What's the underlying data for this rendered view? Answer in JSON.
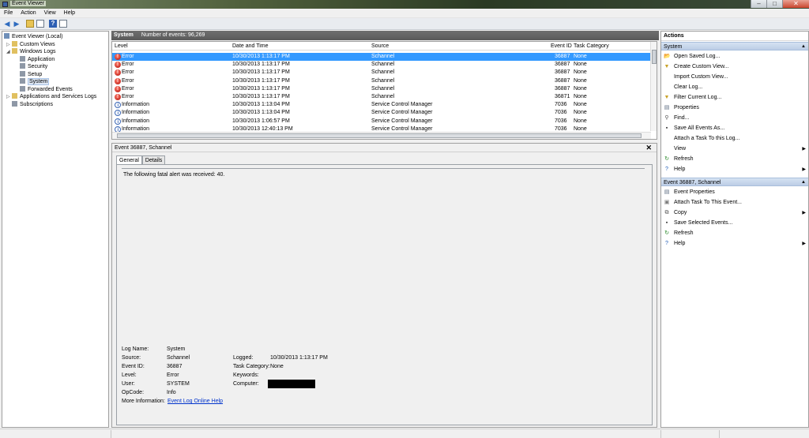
{
  "window": {
    "title": "Event Viewer"
  },
  "menu": [
    "File",
    "Action",
    "View",
    "Help"
  ],
  "tree": {
    "root": "Event Viewer (Local)",
    "custom_views": "Custom Views",
    "windows_logs": "Windows Logs",
    "logs": [
      "Application",
      "Security",
      "Setup",
      "System",
      "Forwarded Events"
    ],
    "app_services": "Applications and Services Logs",
    "subscriptions": "Subscriptions"
  },
  "grid": {
    "title": "System",
    "count_text": "Number of events: 96,269",
    "columns": [
      "Level",
      "Date and Time",
      "Source",
      "Event ID",
      "Task Category"
    ],
    "rows": [
      {
        "level": "Error",
        "date": "10/30/2013 1:13:17 PM",
        "source": "Schannel",
        "id": "36887",
        "task": "None"
      },
      {
        "level": "Error",
        "date": "10/30/2013 1:13:17 PM",
        "source": "Schannel",
        "id": "36887",
        "task": "None"
      },
      {
        "level": "Error",
        "date": "10/30/2013 1:13:17 PM",
        "source": "Schannel",
        "id": "36887",
        "task": "None"
      },
      {
        "level": "Error",
        "date": "10/30/2013 1:13:17 PM",
        "source": "Schannel",
        "id": "36887",
        "task": "None"
      },
      {
        "level": "Error",
        "date": "10/30/2013 1:13:17 PM",
        "source": "Schannel",
        "id": "36887",
        "task": "None"
      },
      {
        "level": "Error",
        "date": "10/30/2013 1:13:17 PM",
        "source": "Schannel",
        "id": "36871",
        "task": "None"
      },
      {
        "level": "Information",
        "date": "10/30/2013 1:13:04 PM",
        "source": "Service Control Manager",
        "id": "7036",
        "task": "None"
      },
      {
        "level": "Information",
        "date": "10/30/2013 1:13:04 PM",
        "source": "Service Control Manager",
        "id": "7036",
        "task": "None"
      },
      {
        "level": "Information",
        "date": "10/30/2013 1:06:57 PM",
        "source": "Service Control Manager",
        "id": "7036",
        "task": "None"
      },
      {
        "level": "Information",
        "date": "10/30/2013 12:40:13 PM",
        "source": "Service Control Manager",
        "id": "7036",
        "task": "None"
      }
    ]
  },
  "detail": {
    "title": "Event 36887, Schannel",
    "tabs": [
      "General",
      "Details"
    ],
    "message": "The following fatal alert was received: 40.",
    "labels": {
      "log_name": "Log Name:",
      "source": "Source:",
      "event_id": "Event ID:",
      "level": "Level:",
      "user": "User:",
      "opcode": "OpCode:",
      "more_info": "More Information:",
      "logged": "Logged:",
      "task_category": "Task Category:",
      "keywords": "Keywords:",
      "computer": "Computer:"
    },
    "values": {
      "log_name": "System",
      "source": "Schannel",
      "event_id": "36887",
      "level": "Error",
      "user": "SYSTEM",
      "opcode": "Info",
      "more_info": "Event Log Online Help",
      "logged": "10/30/2013 1:13:17 PM",
      "task_category": "None",
      "keywords": "",
      "computer": ""
    }
  },
  "actions": {
    "header": "Actions",
    "section1": "System",
    "items1": [
      {
        "label": "Open Saved Log...",
        "icon": "folder-icon"
      },
      {
        "label": "Create Custom View...",
        "icon": "filter-icon"
      },
      {
        "label": "Import Custom View...",
        "icon": ""
      },
      {
        "label": "Clear Log...",
        "icon": ""
      },
      {
        "label": "Filter Current Log...",
        "icon": "filter-icon"
      },
      {
        "label": "Properties",
        "icon": "properties-icon"
      },
      {
        "label": "Find...",
        "icon": "find-icon"
      },
      {
        "label": "Save All Events As...",
        "icon": "save-icon"
      },
      {
        "label": "Attach a Task To this Log...",
        "icon": ""
      },
      {
        "label": "View",
        "icon": "",
        "submenu": true
      },
      {
        "label": "Refresh",
        "icon": "refresh-icon"
      },
      {
        "label": "Help",
        "icon": "help-icon",
        "submenu": true
      }
    ],
    "section2": "Event 36887, Schannel",
    "items2": [
      {
        "label": "Event Properties",
        "icon": "properties-icon"
      },
      {
        "label": "Attach Task To This Event...",
        "icon": "task-icon"
      },
      {
        "label": "Copy",
        "icon": "copy-icon",
        "submenu": true
      },
      {
        "label": "Save Selected Events...",
        "icon": "save-icon"
      },
      {
        "label": "Refresh",
        "icon": "refresh-icon"
      },
      {
        "label": "Help",
        "icon": "help-icon",
        "submenu": true
      }
    ]
  },
  "colors": {
    "selection": "#3399ff",
    "section_header": "#c9d8ee",
    "link": "#0033cc"
  }
}
